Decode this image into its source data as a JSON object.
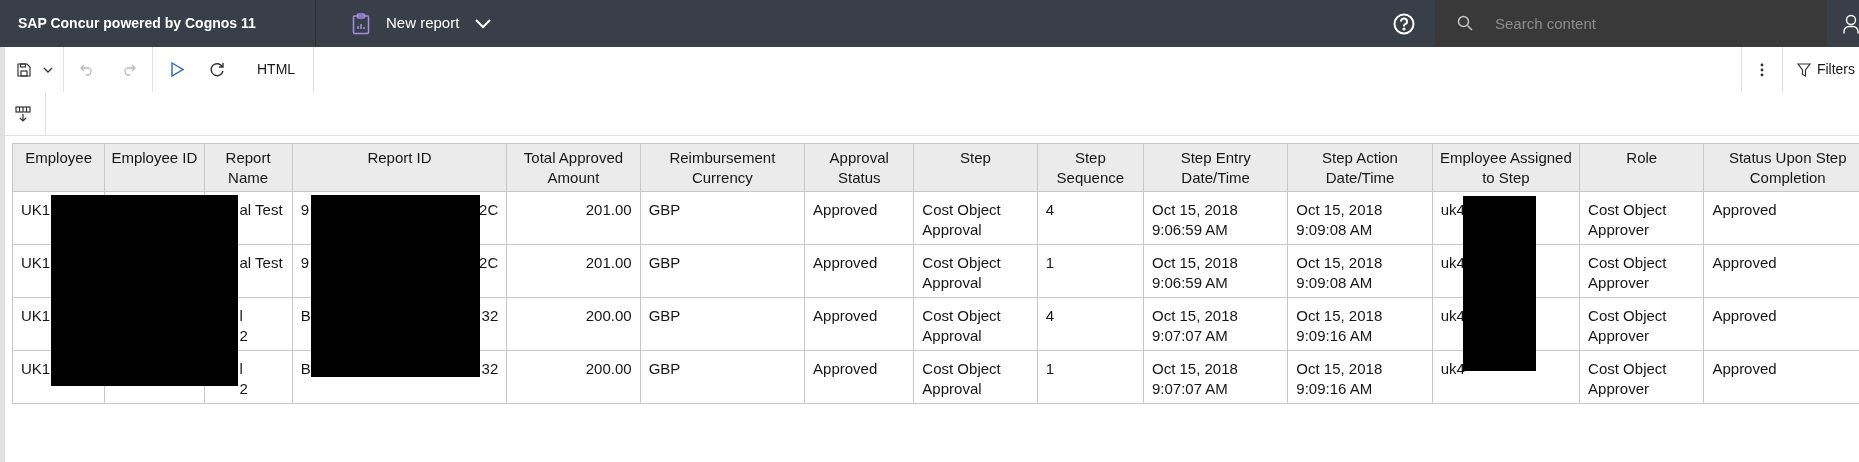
{
  "top_bar": {
    "brand": "SAP Concur powered by Cognos 11",
    "report_title": "New report",
    "search": {
      "placeholder": "Search content"
    }
  },
  "toolbar": {
    "output_format": "HTML",
    "filters_label": "Filters"
  },
  "table": {
    "columns": [
      "Employee",
      "Employee ID",
      "Report Name",
      "Report ID",
      "Total Approved Amount",
      "Reimbursement Currency",
      "Approval Status",
      "Step",
      "Step Sequence",
      "Step Entry Date/Time",
      "Step Action Date/Time",
      "Employee Assigned to Step",
      "Role",
      "Status Upon Step Completion"
    ],
    "rows": [
      {
        "employee": "UK1",
        "report_name": "al Test",
        "report_id_start": "9",
        "report_id_end": "2C",
        "amount": "201.00",
        "currency": "GBP",
        "approval_status": "Approved",
        "step": "Cost Object Approval",
        "sequence": "4",
        "entry": "Oct 15, 2018 9:06:59 AM",
        "action": "Oct 15, 2018 9:09:08 AM",
        "assigned": "uk4",
        "role": "Cost Object Approver",
        "completion_status": "Approved"
      },
      {
        "employee": "UK1",
        "report_name": "al Test",
        "report_id_start": "9",
        "report_id_end": "2C",
        "amount": "201.00",
        "currency": "GBP",
        "approval_status": "Approved",
        "step": "Cost Object Approval",
        "sequence": "1",
        "entry": "Oct 15, 2018 9:06:59 AM",
        "action": "Oct 15, 2018 9:09:08 AM",
        "assigned": "uk4",
        "role": "Cost Object Approver",
        "completion_status": "Approved"
      },
      {
        "employee": "UK1",
        "report_name": "l\n2",
        "report_id_start": "B",
        "report_id_end": "32",
        "amount": "200.00",
        "currency": "GBP",
        "approval_status": "Approved",
        "step": "Cost Object Approval",
        "sequence": "4",
        "entry": "Oct 15, 2018 9:07:07 AM",
        "action": "Oct 15, 2018 9:09:16 AM",
        "assigned": "uk4",
        "role": "Cost Object Approver",
        "completion_status": "Approved"
      },
      {
        "employee": "UK1",
        "report_name": "l\n2",
        "report_id_start": "B",
        "report_id_end": "32",
        "amount": "200.00",
        "currency": "GBP",
        "approval_status": "Approved",
        "step": "Cost Object Approval",
        "sequence": "1",
        "entry": "Oct 15, 2018 9:07:07 AM",
        "action": "Oct 15, 2018 9:09:16 AM",
        "assigned": "uk4",
        "role": "Cost Object Approver",
        "completion_status": "Approved"
      }
    ]
  }
}
